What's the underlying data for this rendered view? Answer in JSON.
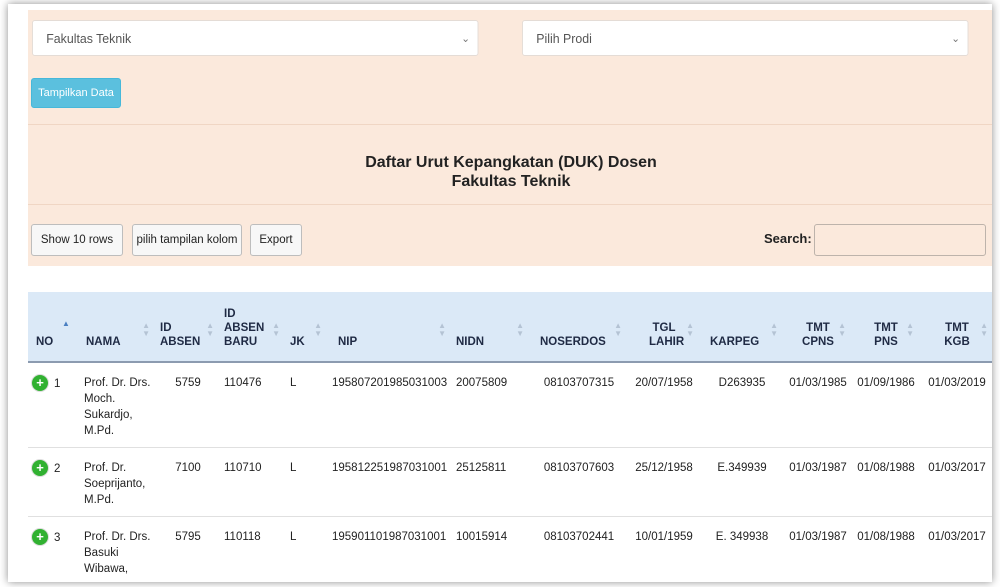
{
  "filters": {
    "fakultas": "Fakultas Teknik",
    "prodi": "Pilih Prodi",
    "show_button": "Tampilkan Data"
  },
  "heading": {
    "line1": "Daftar Urut Kepangkatan (DUK) Dosen",
    "line2": "Fakultas Teknik"
  },
  "toolbar": {
    "show_rows": "Show 10 rows",
    "columns": "pilih tampilan kolom",
    "export": "Export",
    "search_label": "Search:"
  },
  "table": {
    "columns": [
      "NO",
      "NAMA",
      "ID ABSEN",
      "ID ABSEN BARU",
      "JK",
      "NIP",
      "NIDN",
      "NOSERDOS",
      "TGL LAHIR",
      "KARPEG",
      "TMT CPNS",
      "TMT PNS",
      "TMT KGB"
    ],
    "rows": [
      {
        "no": "1",
        "nama": "Prof. Dr. Drs. Moch. Sukardjo, M.Pd.",
        "id_absen": "5759",
        "id_absen_baru": "110476",
        "jk": "L",
        "nip": "195807201985031003",
        "nidn": "20075809",
        "noserdos": "08103707315",
        "tgl_lahir": "20/07/1958",
        "karpeg": "D263935",
        "tmt_cpns": "01/03/1985",
        "tmt_pns": "01/09/1986",
        "tmt_kgb": "01/03/2019"
      },
      {
        "no": "2",
        "nama": "Prof. Dr. Soeprijanto, M.Pd.",
        "id_absen": "7100",
        "id_absen_baru": "110710",
        "jk": "L",
        "nip": "195812251987031001",
        "nidn": "25125811",
        "noserdos": "08103707603",
        "tgl_lahir": "25/12/1958",
        "karpeg": "E.349939",
        "tmt_cpns": "01/03/1987",
        "tmt_pns": "01/08/1988",
        "tmt_kgb": "01/03/2017"
      },
      {
        "no": "3",
        "nama": "Prof. Dr. Drs. Basuki Wibawa,",
        "id_absen": "5795",
        "id_absen_baru": "110118",
        "jk": "L",
        "nip": "195901101987031001",
        "nidn": "10015914",
        "noserdos": "08103702441",
        "tgl_lahir": "10/01/1959",
        "karpeg": "E. 349938",
        "tmt_cpns": "01/03/1987",
        "tmt_pns": "01/08/1988",
        "tmt_kgb": "01/03/2017"
      }
    ]
  },
  "icons": {
    "expand": "plus-circle-icon",
    "select_arrow": "chevron-down-icon",
    "sort": "sort-icon"
  },
  "colors": {
    "panel_bg": "#fbe9dc",
    "button_info": "#5bc0de",
    "table_header_bg": "#dbe9f7",
    "expand_green": "#31b131"
  }
}
